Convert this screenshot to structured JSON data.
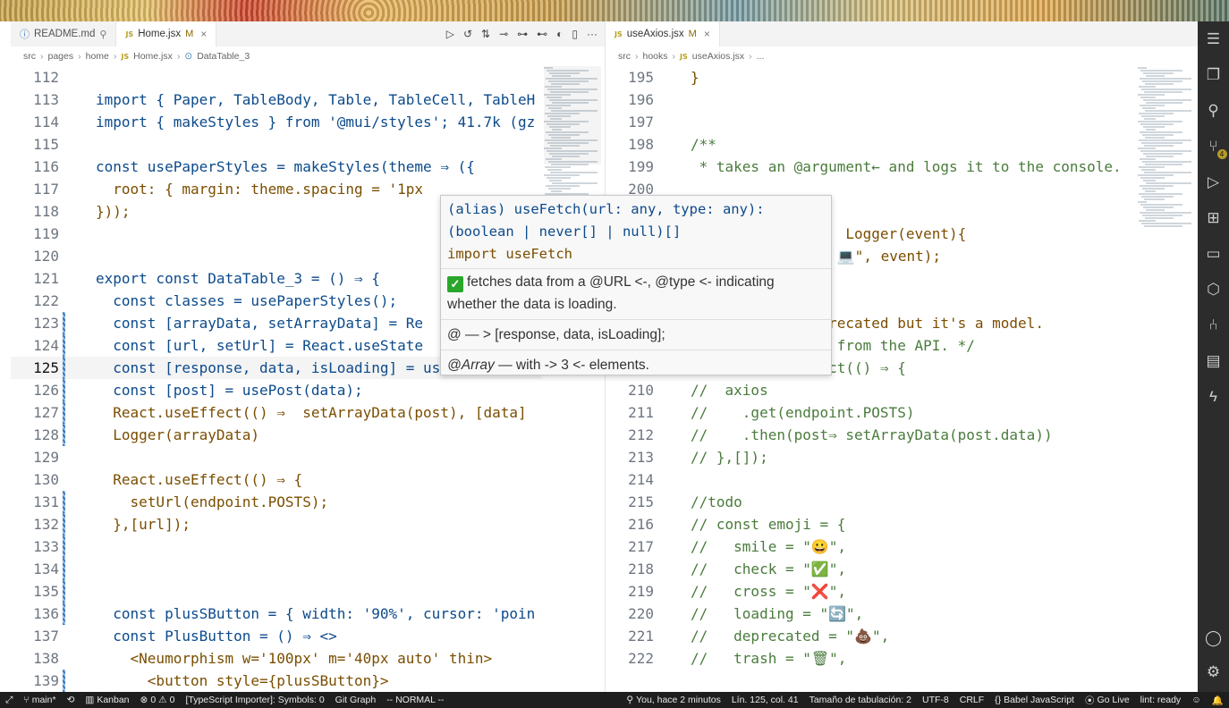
{
  "left_editor": {
    "tabs": [
      {
        "label": "README.md",
        "badge": "md",
        "pinned": true
      },
      {
        "label": "Home.jsx",
        "badge": "JS",
        "modified": "M",
        "active": true
      }
    ],
    "breadcrumb": [
      "src",
      "pages",
      "home",
      "Home.jsx",
      "DataTable_3"
    ],
    "lines": [
      {
        "n": "112",
        "t": ""
      },
      {
        "n": "113",
        "t": "import { Paper, TableBody, Table, TableCell, TableH"
      },
      {
        "n": "114",
        "t": "import { makeStyles } from '@mui/styles'; 41.7k (gz"
      },
      {
        "n": "115",
        "t": ""
      },
      {
        "n": "116",
        "t": "const usePaperStyles = makeStyles(theme ⇒ ({"
      },
      {
        "n": "117",
        "t": "  root: { margin: theme.spacing = '1px"
      },
      {
        "n": "118",
        "t": "}));"
      },
      {
        "n": "119",
        "t": ""
      },
      {
        "n": "120",
        "t": ""
      },
      {
        "n": "121",
        "t": "export const DataTable_3 = () ⇒ {"
      },
      {
        "n": "122",
        "t": "  const classes = usePaperStyles();"
      },
      {
        "n": "123",
        "t": "  const [arrayData, setArrayData] = Re"
      },
      {
        "n": "124",
        "t": "  const [url, setUrl] = React.useState"
      },
      {
        "n": "125",
        "t": "  const [response, data, isLoading] = useFetch(url,"
      },
      {
        "n": "126",
        "t": "  const [post] = usePost(data);"
      },
      {
        "n": "127",
        "t": "  React.useEffect(() ⇒  setArrayData(post), [data]"
      },
      {
        "n": "128",
        "t": "  Logger(arrayData)"
      },
      {
        "n": "129",
        "t": ""
      },
      {
        "n": "130",
        "t": "  React.useEffect(() ⇒ {"
      },
      {
        "n": "131",
        "t": "    setUrl(endpoint.POSTS);"
      },
      {
        "n": "132",
        "t": "  },[url]);"
      },
      {
        "n": "133",
        "t": ""
      },
      {
        "n": "134",
        "t": ""
      },
      {
        "n": "135",
        "t": ""
      },
      {
        "n": "136",
        "t": "  const plusSButton = { width: '90%', cursor: 'poin"
      },
      {
        "n": "137",
        "t": "  const PlusButton = () ⇒ <>"
      },
      {
        "n": "138",
        "t": "    <Neumorphism w='100px' m='40px auto' thin>"
      },
      {
        "n": "139",
        "t": "      <button style={plusSButton}>"
      }
    ]
  },
  "right_editor": {
    "tabs": [
      {
        "label": "useAxios.jsx",
        "badge": "JS",
        "modified": "M",
        "active": true
      }
    ],
    "breadcrumb": [
      "src",
      "hooks",
      "useAxios.jsx",
      "..."
    ],
    "lines": [
      {
        "n": "195",
        "t": "}"
      },
      {
        "n": "196",
        "t": ""
      },
      {
        "n": "197",
        "t": ""
      },
      {
        "n": "198",
        "t": "/**"
      },
      {
        "n": "199",
        "t": " * takes an @argument← and logs it to the console."
      },
      {
        "n": "200",
        "t": ""
      },
      {
        "n": "201",
        "t": ""
      },
      {
        "n": "202",
        "t": "                  Logger(event){"
      },
      {
        "n": "203",
        "t": "                 💻\", event);"
      },
      {
        "n": "204",
        "t": ""
      },
      {
        "n": "205",
        "t": ""
      },
      {
        "n": "206",
        "t": "                recated but it's a model."
      },
      {
        "n": "208",
        "t": " * Fetching data from the API. */"
      },
      {
        "n": "209",
        "t": "// React.useEffect(() ⇒ {"
      },
      {
        "n": "210",
        "t": "//  axios"
      },
      {
        "n": "211",
        "t": "//    .get(endpoint.POSTS)"
      },
      {
        "n": "212",
        "t": "//    .then(post⇒ setArrayData(post.data))"
      },
      {
        "n": "213",
        "t": "// },[]);"
      },
      {
        "n": "214",
        "t": ""
      },
      {
        "n": "215",
        "t": "//todo"
      },
      {
        "n": "216",
        "t": "// const emoji = {"
      },
      {
        "n": "217",
        "t": "//   smile = \"😀\","
      },
      {
        "n": "218",
        "t": "//   check = \"✅\","
      },
      {
        "n": "219",
        "t": "//   cross = \"❌\","
      },
      {
        "n": "220",
        "t": "//   loading = \"🔄\","
      },
      {
        "n": "221",
        "t": "//   deprecated = \"💩\","
      },
      {
        "n": "222",
        "t": "//   trash = \"🗑\","
      }
    ]
  },
  "hover": {
    "signature_1": "(alias) useFetch(url: any, type: any):",
    "signature_2": "(boolean | never[] | null)[]",
    "signature_3": "import useFetch",
    "desc": "fetches data from a @URL <-, @type <- indicating whether the data is loading.",
    "returns": "@ — > [response, data, isLoading];",
    "array_tag": "@Array",
    "array_rest": " — with -> 3 <- elements."
  },
  "statusbar": {
    "branch": "main*",
    "kanban": "Kanban",
    "errors": "0",
    "warnings": "0",
    "importer": "[TypeScript Importer]: Symbols: 0",
    "git_graph": "Git Graph",
    "vim_mode": "-- NORMAL --",
    "blame": "You, hace 2 minutos",
    "position": "Lín. 125, col. 41",
    "tab_size": "Tamaño de tabulación: 2",
    "encoding": "UTF-8",
    "eol": "CRLF",
    "language": "Babel JavaScript",
    "live": "Go Live",
    "lint": "lint: ready"
  },
  "colors": {
    "activity_bar": "#2c2c2c",
    "statusbar": "#1e1e1e",
    "keyword": "#0c4a8b",
    "string": "#a3541a",
    "comment": "#4a7b3c"
  }
}
